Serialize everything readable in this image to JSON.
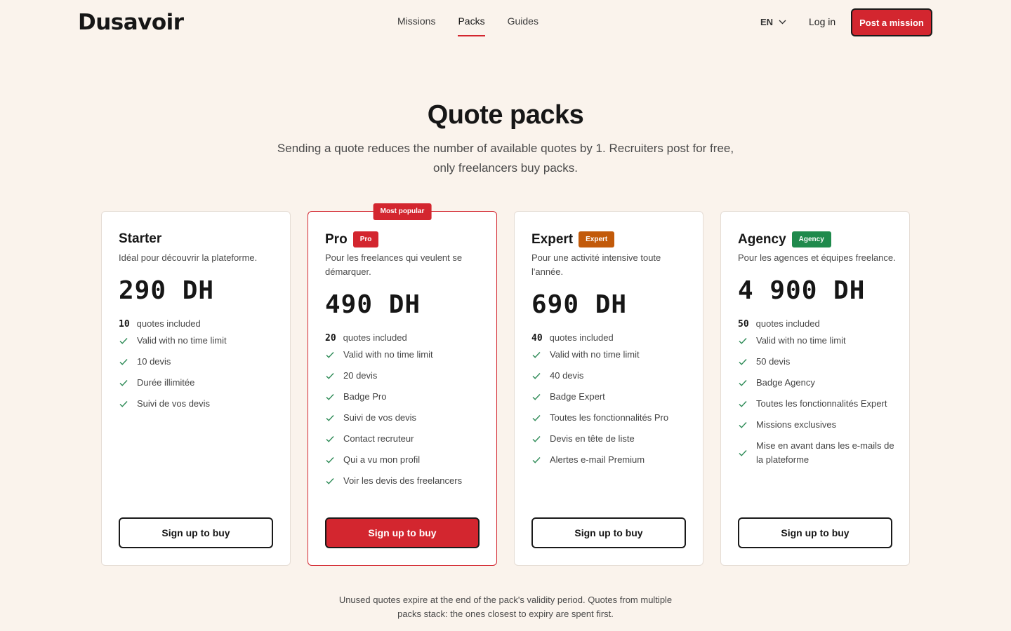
{
  "brand": {
    "logo_text": "Dusavoir"
  },
  "nav": {
    "items": [
      {
        "label": "Missions"
      },
      {
        "label": "Packs"
      },
      {
        "label": "Guides"
      }
    ],
    "active": "Packs"
  },
  "header": {
    "lang": "EN",
    "login": "Log in",
    "post_mission": "Post a mission"
  },
  "hero": {
    "title": "Quote packs",
    "subtitle": "Sending a quote reduces the number of available quotes by 1. Recruiters post for free, only freelancers buy packs."
  },
  "packs": [
    {
      "name": "Starter",
      "badge": "",
      "badge_color": "",
      "description": "Idéal pour découvrir la plateforme.",
      "price": "290 DH",
      "quotes_count": "10",
      "quotes_label": "quotes included",
      "features": [
        "Valid with no time limit",
        "10 devis",
        "Durée illimitée",
        "Suivi de vos devis"
      ],
      "cta": "Sign up to buy"
    },
    {
      "name": "Pro",
      "badge": "Pro",
      "badge_color": "#d3262f",
      "popular_label": "Most popular",
      "description": "Pour les freelances qui veulent se démarquer.",
      "price": "490 DH",
      "quotes_count": "20",
      "quotes_label": "quotes included",
      "features": [
        "Valid with no time limit",
        "20 devis",
        "Badge Pro",
        "Suivi de vos devis",
        "Contact recruteur",
        "Qui a vu mon profil",
        "Voir les devis des freelancers"
      ],
      "cta": "Sign up to buy"
    },
    {
      "name": "Expert",
      "badge": "Expert",
      "badge_color": "#c25a0a",
      "description": "Pour une activité intensive toute l'année.",
      "price": "690 DH",
      "quotes_count": "40",
      "quotes_label": "quotes included",
      "features": [
        "Valid with no time limit",
        "40 devis",
        "Badge Expert",
        "Toutes les fonctionnalités Pro",
        "Devis en tête de liste",
        "Alertes e-mail Premium"
      ],
      "cta": "Sign up to buy"
    },
    {
      "name": "Agency",
      "badge": "Agency",
      "badge_color": "#1f8a4c",
      "description": "Pour les agences et équipes freelance.",
      "price": "4 900 DH",
      "quotes_count": "50",
      "quotes_label": "quotes included",
      "features": [
        "Valid with no time limit",
        "50 devis",
        "Badge Agency",
        "Toutes les fonctionnalités Expert",
        "Missions exclusives",
        "Mise en avant dans les e-mails de la plateforme"
      ],
      "cta": "Sign up to buy"
    }
  ],
  "footnote": "Unused quotes expire at the end of the pack's validity period. Quotes from multiple packs stack: the ones closest to expiry are spent first.",
  "colors": {
    "accent": "#d3262f",
    "background": "#faf3ec",
    "check": "#2e8b57"
  }
}
